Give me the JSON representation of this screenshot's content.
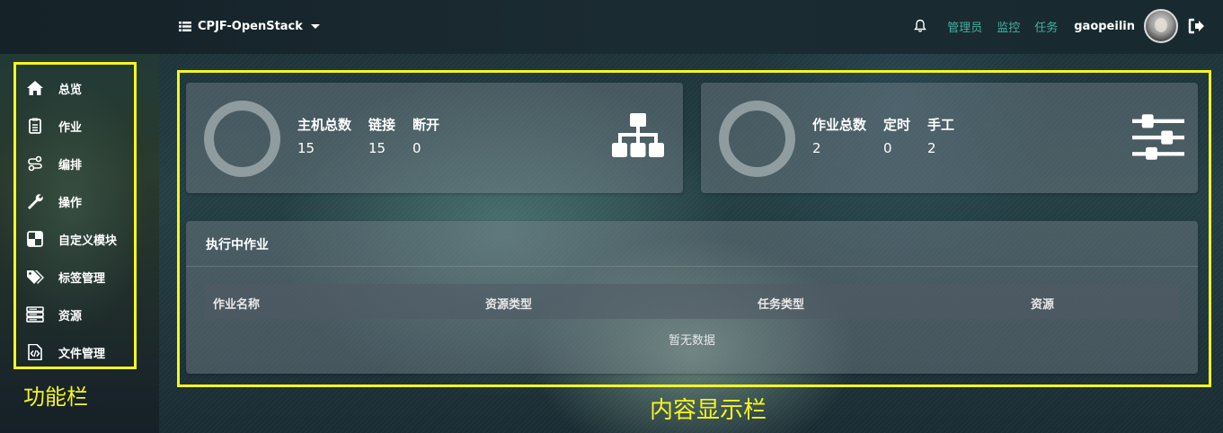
{
  "topbar": {
    "project_name": "CPJF-OpenStack",
    "links": [
      "管理员",
      "监控",
      "任务"
    ],
    "username": "gaopeilin"
  },
  "sidebar": {
    "items": [
      {
        "label": "总览",
        "icon": "home-icon"
      },
      {
        "label": "作业",
        "icon": "clipboard-icon"
      },
      {
        "label": "编排",
        "icon": "workflow-icon"
      },
      {
        "label": "操作",
        "icon": "wrench-icon"
      },
      {
        "label": "自定义模块",
        "icon": "puzzle-icon"
      },
      {
        "label": "标签管理",
        "icon": "tags-icon"
      },
      {
        "label": "资源",
        "icon": "server-icon"
      },
      {
        "label": "文件管理",
        "icon": "code-file-icon"
      }
    ]
  },
  "annotations": {
    "left": "功能栏",
    "right": "内容显示栏"
  },
  "hosts_card": {
    "stats": [
      {
        "label": "主机总数",
        "value": "15"
      },
      {
        "label": "链接",
        "value": "15"
      },
      {
        "label": "断开",
        "value": "0"
      }
    ],
    "icon": "network-tree-icon"
  },
  "jobs_summary_card": {
    "stats": [
      {
        "label": "作业总数",
        "value": "2"
      },
      {
        "label": "定时",
        "value": "0"
      },
      {
        "label": "手工",
        "value": "2"
      }
    ],
    "icon": "sliders-icon"
  },
  "running_jobs": {
    "title": "执行中作业",
    "columns": [
      "作业名称",
      "资源类型",
      "任务类型",
      "资源"
    ],
    "empty_text": "暂无数据"
  },
  "colors": {
    "annotation_yellow": "#f5f51e",
    "link_teal": "#45b0a0"
  }
}
